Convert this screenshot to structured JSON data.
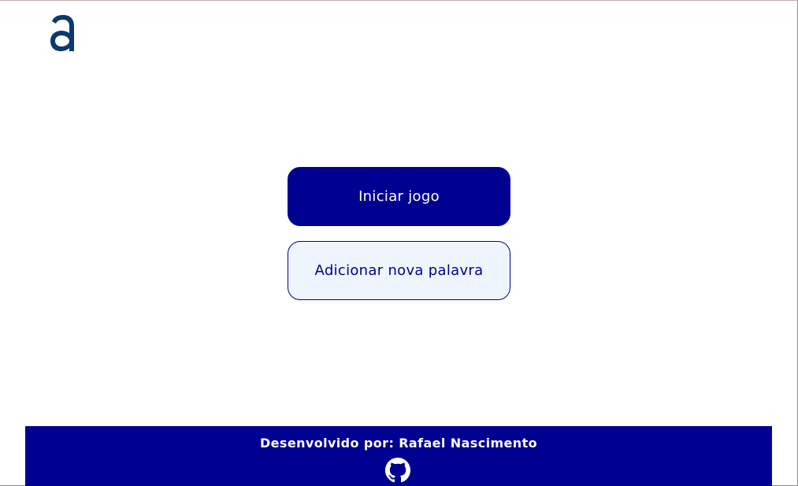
{
  "header": {
    "logo_icon": "alura-a-logo-icon"
  },
  "main": {
    "start_button_label": "Iniciar jogo",
    "add_word_button_label": "Adicionar nova palavra"
  },
  "footer": {
    "credit_text": "Desenvolvido por: Rafael Nascimento",
    "github_icon": "github-icon"
  },
  "colors": {
    "primary": "#000091",
    "secondary_bg": "#eef5fc",
    "logo": "#0a3a6e"
  }
}
